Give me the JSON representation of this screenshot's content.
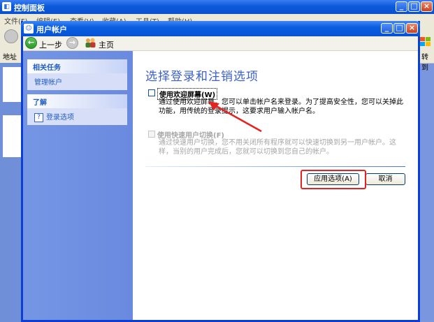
{
  "bg_window": {
    "title": "控制面板",
    "menu": [
      "文件(F)",
      "编辑(E)",
      "查看(V)",
      "收藏(A)",
      "工具(T)",
      "帮助(H)"
    ],
    "address_label": "地址",
    "right_fragment": "转到"
  },
  "window": {
    "title": "用户帐户",
    "toolbar": {
      "back_label": "上一步",
      "home_label": "主页"
    }
  },
  "sidebar": {
    "tasks_header": "相关任务",
    "tasks_item": "管理帐户",
    "learn_header": "了解",
    "learn_item": "登录选项"
  },
  "main": {
    "heading": "选择登录和注销选项",
    "option1_label": "使用欢迎屏幕(W)",
    "option1_desc": "通过使用欢迎屏幕，您可以单击帐户名来登录。为了提高安全性，您可以关掉此功能，用传统的登录提示，这要求用户输入帐户名。",
    "option2_label": "使用快速用户切换(F)",
    "option2_desc": "通过快速用户切换，您不用关闭所有程序就可以快速切换到另一用户帐户。这样，当别的用户完成后，您就可以切换到您自己的帐户。",
    "apply_button": "应用选项(A)",
    "cancel_button": "取消"
  },
  "colors": {
    "title_blue": "#0a5bdb",
    "heading_blue": "#3b5fcc",
    "highlight_red": "#e52222"
  }
}
